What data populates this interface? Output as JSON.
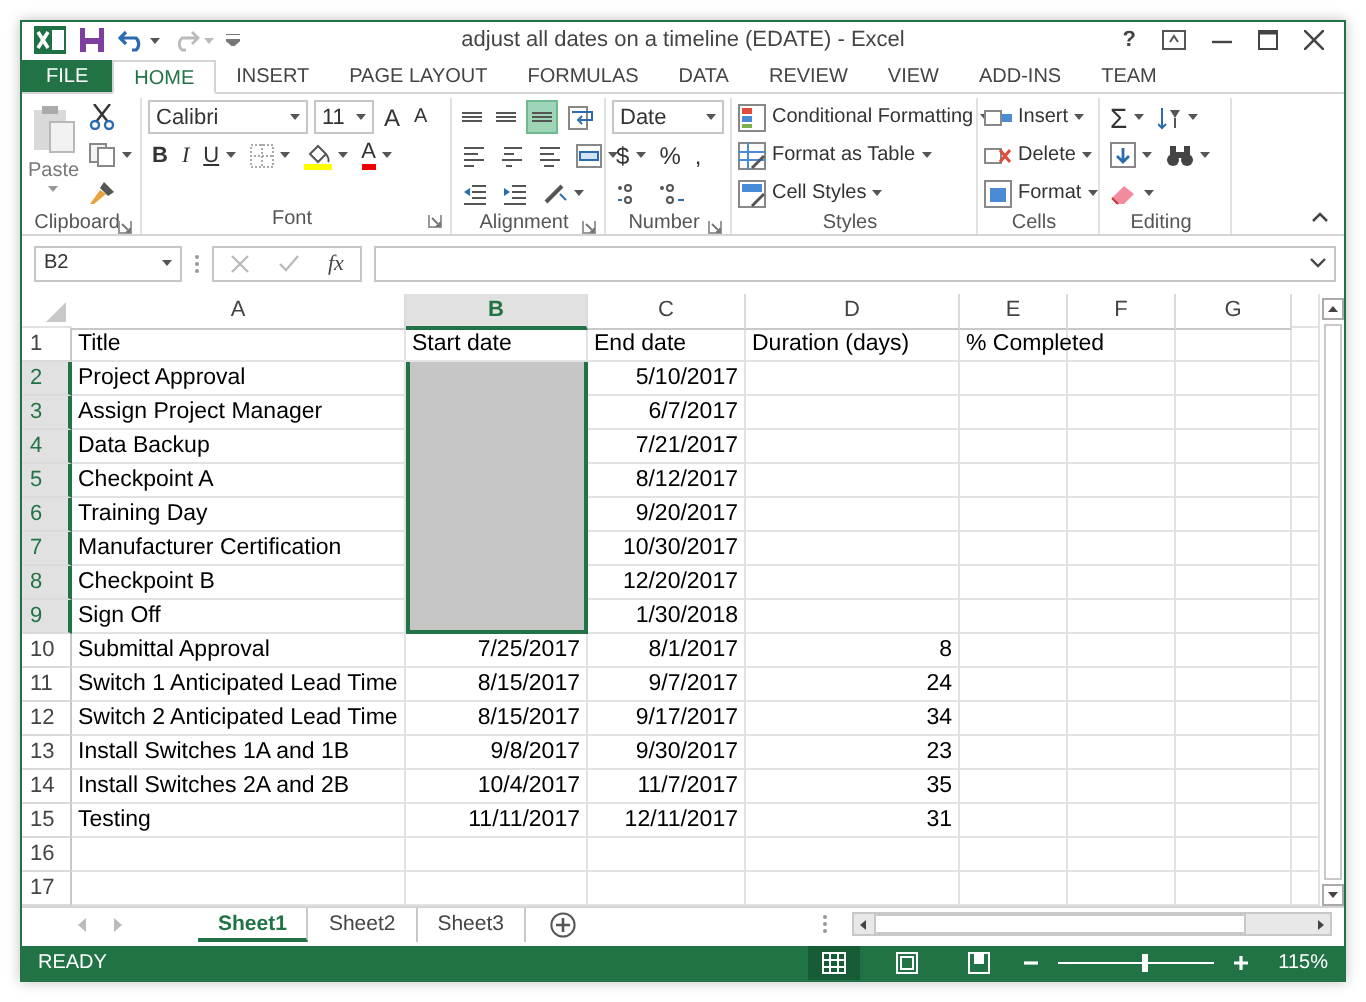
{
  "window": {
    "title": "adjust all dates on a timeline (EDATE) - Excel",
    "help": "?"
  },
  "tabs": [
    {
      "label": "FILE",
      "kind": "file",
      "selected": false
    },
    {
      "label": "HOME",
      "kind": "tab",
      "selected": true
    },
    {
      "label": "INSERT",
      "kind": "tab",
      "selected": false
    },
    {
      "label": "PAGE LAYOUT",
      "kind": "tab",
      "selected": false
    },
    {
      "label": "FORMULAS",
      "kind": "tab",
      "selected": false
    },
    {
      "label": "DATA",
      "kind": "tab",
      "selected": false
    },
    {
      "label": "REVIEW",
      "kind": "tab",
      "selected": false
    },
    {
      "label": "VIEW",
      "kind": "tab",
      "selected": false
    },
    {
      "label": "ADD-INS",
      "kind": "tab",
      "selected": false
    },
    {
      "label": "TEAM",
      "kind": "tab",
      "selected": false
    }
  ],
  "ribbon": {
    "clipboard": {
      "paste": "Paste",
      "label": "Clipboard"
    },
    "font": {
      "name": "Calibri",
      "size": "11",
      "grow": "A",
      "shrink": "A",
      "bold": "B",
      "italic": "I",
      "underline": "U",
      "font_color_glyph": "A",
      "label": "Font"
    },
    "alignment": {
      "vertical": [
        {
          "selected": false
        },
        {
          "selected": false
        },
        {
          "selected": true
        }
      ],
      "label": "Alignment"
    },
    "number": {
      "format": "Date",
      "currency": "$",
      "percent": "%",
      "comma": ",",
      "label": "Number"
    },
    "styles": {
      "items": [
        "Conditional Formatting",
        "Format as Table",
        "Cell Styles"
      ],
      "label": "Styles"
    },
    "cells": {
      "items": [
        "Insert",
        "Delete",
        "Format"
      ],
      "label": "Cells"
    },
    "editing": {
      "sum": "Σ",
      "label": "Editing"
    }
  },
  "formula_bar": {
    "name_box": "B2",
    "function": "fx"
  },
  "columns": [
    {
      "label": "A",
      "selected": false
    },
    {
      "label": "B",
      "selected": true
    },
    {
      "label": "C",
      "selected": false
    },
    {
      "label": "D",
      "selected": false
    },
    {
      "label": "E",
      "selected": false
    },
    {
      "label": "F",
      "selected": false
    },
    {
      "label": "G",
      "selected": false
    }
  ],
  "rows": [
    {
      "number": "1",
      "kind": "header",
      "selected": false,
      "title": "Title",
      "start_date": "Start date",
      "end_date": "End date",
      "duration": "Duration (days)",
      "completed": "% Completed"
    },
    {
      "number": "2",
      "kind": "data",
      "selected": true,
      "title": "Project Approval",
      "end_date": "5/10/2017"
    },
    {
      "number": "3",
      "kind": "data",
      "selected": true,
      "title": "Assign Project Manager",
      "end_date": "6/7/2017"
    },
    {
      "number": "4",
      "kind": "data",
      "selected": true,
      "title": "Data Backup",
      "end_date": "7/21/2017"
    },
    {
      "number": "5",
      "kind": "data",
      "selected": true,
      "title": "Checkpoint A",
      "end_date": "8/12/2017"
    },
    {
      "number": "6",
      "kind": "data",
      "selected": true,
      "title": "Training Day",
      "end_date": "9/20/2017"
    },
    {
      "number": "7",
      "kind": "data",
      "selected": true,
      "title": "Manufacturer Certification",
      "end_date": "10/30/2017"
    },
    {
      "number": "8",
      "kind": "data",
      "selected": true,
      "title": "Checkpoint B",
      "end_date": "12/20/2017"
    },
    {
      "number": "9",
      "kind": "data",
      "selected": true,
      "title": "Sign Off",
      "end_date": "1/30/2018"
    },
    {
      "number": "10",
      "kind": "data",
      "selected": false,
      "title": "Submittal Approval",
      "start_date": "7/25/2017",
      "end_date": "8/1/2017",
      "duration": "8"
    },
    {
      "number": "11",
      "kind": "data",
      "selected": false,
      "title": "Switch 1 Anticipated Lead Time",
      "start_date": "8/15/2017",
      "end_date": "9/7/2017",
      "duration": "24"
    },
    {
      "number": "12",
      "kind": "data",
      "selected": false,
      "title": "Switch 2 Anticipated Lead Time",
      "start_date": "8/15/2017",
      "end_date": "9/17/2017",
      "duration": "34"
    },
    {
      "number": "13",
      "kind": "data",
      "selected": false,
      "title": "Install Switches 1A and 1B",
      "start_date": "9/8/2017",
      "end_date": "9/30/2017",
      "duration": "23"
    },
    {
      "number": "14",
      "kind": "data",
      "selected": false,
      "title": "Install Switches 2A and 2B",
      "start_date": "10/4/2017",
      "end_date": "11/7/2017",
      "duration": "35"
    },
    {
      "number": "15",
      "kind": "data",
      "selected": false,
      "title": "Testing",
      "start_date": "11/11/2017",
      "end_date": "12/11/2017",
      "duration": "31"
    },
    {
      "number": "16",
      "kind": "data",
      "selected": false
    },
    {
      "number": "17",
      "kind": "data",
      "selected": false
    }
  ],
  "sheets": [
    {
      "label": "Sheet1",
      "selected": true
    },
    {
      "label": "Sheet2",
      "selected": false
    },
    {
      "label": "Sheet3",
      "selected": false
    }
  ],
  "status_bar": {
    "mode": "READY",
    "zoom": "115%",
    "zoom_slider": {
      "level": 0.55
    }
  }
}
